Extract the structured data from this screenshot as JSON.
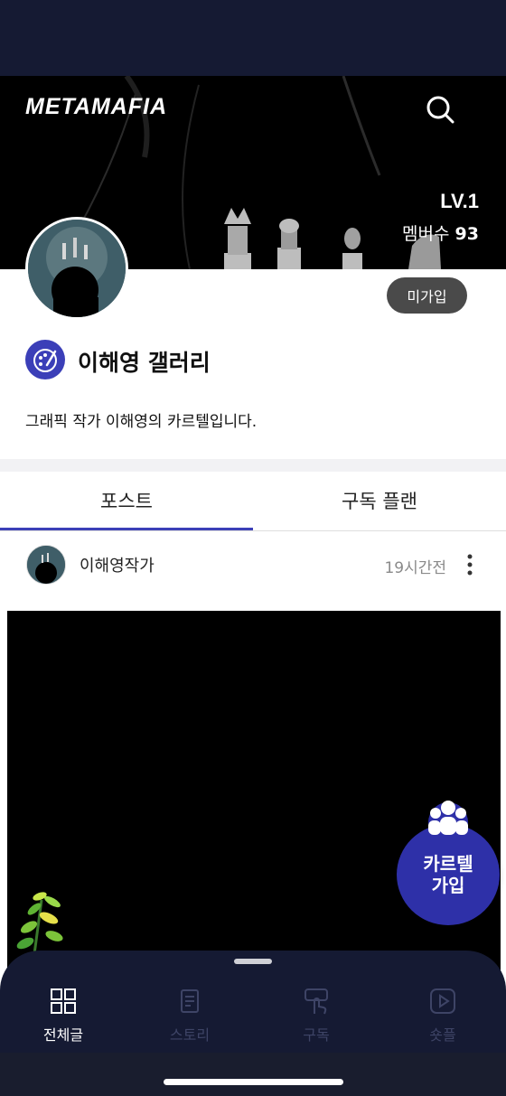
{
  "header": {
    "logo": "METAMAFIA",
    "level": "LV.1",
    "members_label": "멤버수",
    "members_count": "93"
  },
  "profile": {
    "join_label": "미가입",
    "title": "이해영 갤러리",
    "description": "그래픽 작가 이해영의 카르텔입니다."
  },
  "tabs": [
    {
      "label": "포스트",
      "active": true
    },
    {
      "label": "구독 플랜",
      "active": false
    }
  ],
  "post": {
    "author": "이해영작가",
    "time": "19시간전"
  },
  "fab": {
    "line1": "카르텔",
    "line2": "가입"
  },
  "bottom_nav": [
    {
      "label": "전체글",
      "icon": "grid-icon",
      "active": true
    },
    {
      "label": "스토리",
      "icon": "document-icon",
      "active": false
    },
    {
      "label": "구독",
      "icon": "subscribe-icon",
      "active": false
    },
    {
      "label": "숏플",
      "icon": "play-icon",
      "active": false
    }
  ],
  "colors": {
    "accent": "#3c40b8",
    "status_bar": "#151a33",
    "join_button": "#4a4a4a"
  }
}
